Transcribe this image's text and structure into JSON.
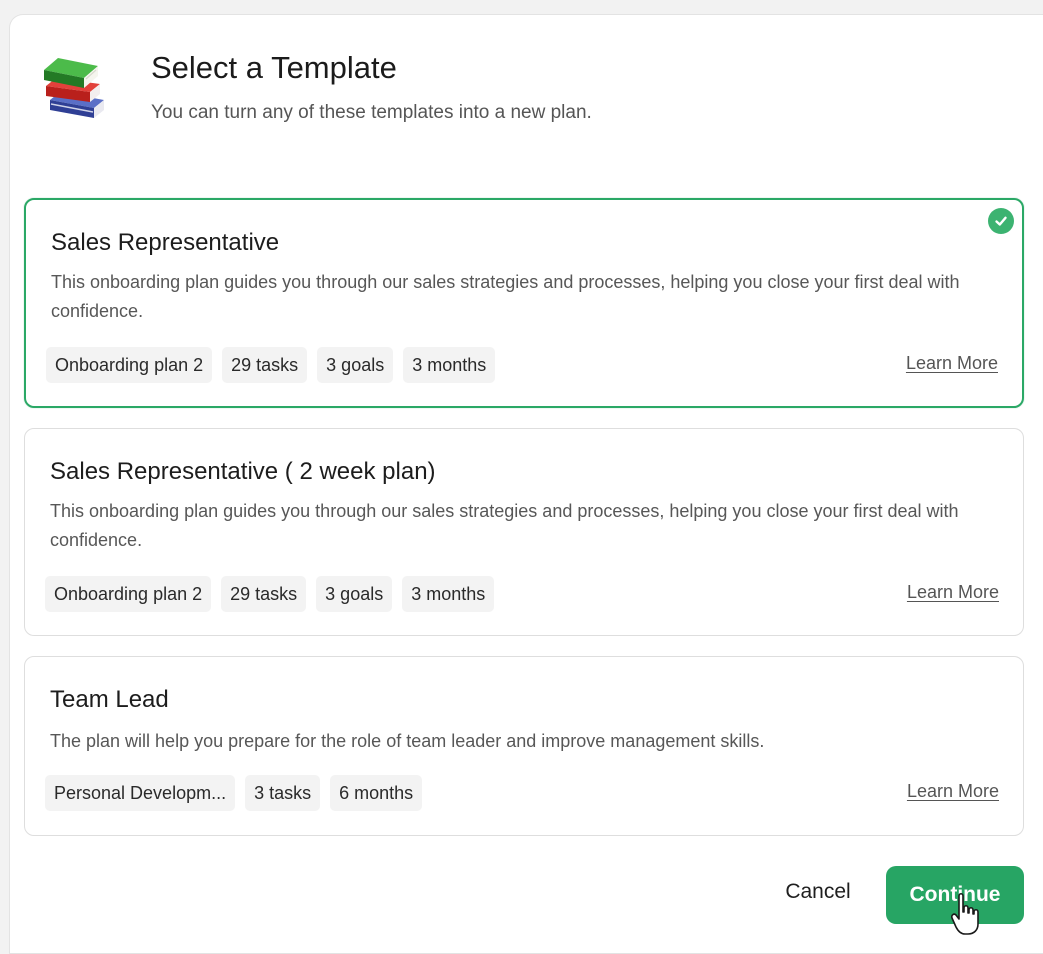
{
  "header": {
    "title": "Select a Template",
    "subtitle": "You can turn any of these templates into a new plan.",
    "icon": "books-icon"
  },
  "templates": [
    {
      "title": "Sales Representative",
      "description": "This onboarding plan guides you through our sales strategies and processes, helping you close your first deal with confidence.",
      "tags": [
        "Onboarding plan 2",
        "29 tasks",
        "3 goals",
        "3 months"
      ],
      "learn_more": "Learn More",
      "selected": true
    },
    {
      "title": "Sales Representative ( 2 week plan)",
      "description": "This onboarding plan guides you through our sales strategies and processes, helping you close your first deal with confidence.",
      "tags": [
        "Onboarding plan 2",
        "29 tasks",
        "3 goals",
        "3 months"
      ],
      "learn_more": "Learn More",
      "selected": false
    },
    {
      "title": "Team Lead",
      "description": "The plan will help you prepare for the role of team leader and improve management skills.",
      "tags": [
        "Personal Developm...",
        "3 tasks",
        "6 months"
      ],
      "learn_more": "Learn More",
      "selected": false
    }
  ],
  "footer": {
    "cancel_label": "Cancel",
    "continue_label": "Continue"
  },
  "colors": {
    "accent": "#27a564",
    "selected_border": "#2ba866",
    "check": "#3cb371"
  }
}
